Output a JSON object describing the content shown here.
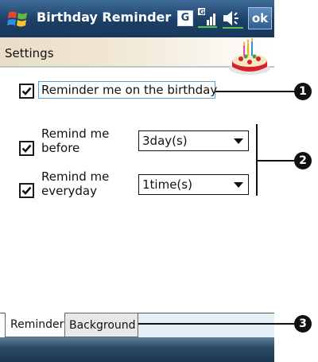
{
  "title_bar": {
    "app_title": "Birthday Reminder",
    "g_icon_text": "G",
    "ok_label": "ok"
  },
  "header": {
    "title": "Settings"
  },
  "settings": {
    "birthday_reminder": {
      "label": "Reminder me on the birthday",
      "checked": true
    },
    "remind_before": {
      "label_line1": "Remind me",
      "label_line2": "before",
      "checked": true,
      "value": "3day(s)"
    },
    "remind_everyday": {
      "label_line1": "Remind me",
      "label_line2": "everyday",
      "checked": true,
      "value": "1time(s)"
    }
  },
  "tabs": [
    {
      "label": "Reminder",
      "active": true
    },
    {
      "label": "Background",
      "active": false
    }
  ],
  "callouts": [
    "1",
    "2",
    "3"
  ],
  "colors": {
    "title_bar": "#1b3f66",
    "header_band": "#e9ddc6",
    "focus_border": "#5aa0d8",
    "tab_strip": "#e3f1f6"
  },
  "icons": [
    "windows-logo-icon",
    "g-icon",
    "signal-icon",
    "volume-icon",
    "cake-icon",
    "checkbox-checked-icon",
    "dropdown-arrow-icon"
  ]
}
